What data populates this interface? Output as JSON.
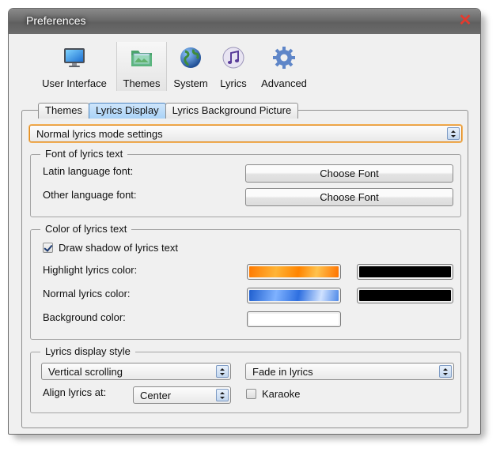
{
  "window": {
    "title": "Preferences"
  },
  "toolbar": {
    "items": [
      {
        "label": "User Interface",
        "icon": "monitor-icon"
      },
      {
        "label": "Themes",
        "icon": "themes-folder-icon"
      },
      {
        "label": "System",
        "icon": "globe-icon"
      },
      {
        "label": "Lyrics",
        "icon": "music-note-icon"
      },
      {
        "label": "Advanced",
        "icon": "gear-icon"
      }
    ],
    "selected": "Themes"
  },
  "tabs": {
    "items": [
      "Themes",
      "Lyrics Display",
      "Lyrics Background Picture"
    ],
    "active": "Lyrics Display"
  },
  "mode_select": {
    "value": "Normal lyrics mode settings"
  },
  "font_group": {
    "title": "Font of lyrics text",
    "latin_label": "Latin language font:",
    "other_label": "Other language font:",
    "choose_font_label": "Choose Font"
  },
  "color_group": {
    "title": "Color of lyrics text",
    "draw_shadow_label": "Draw shadow of lyrics text",
    "draw_shadow_checked": true,
    "highlight_label": "Highlight lyrics color:",
    "normal_label": "Normal lyrics color:",
    "background_label": "Background color:",
    "colors": {
      "highlight_gradient": "#ff8a00",
      "highlight_shadow": "#000000",
      "normal_gradient": "#2f6fd6",
      "normal_shadow": "#000000",
      "background": "#ffffff"
    }
  },
  "style_group": {
    "title": "Lyrics display style",
    "scroll_select": "Vertical scrolling",
    "effect_select": "Fade in lyrics",
    "align_label": "Align lyrics at:",
    "align_select": "Center",
    "karaoke_label": "Karaoke",
    "karaoke_checked": false
  }
}
